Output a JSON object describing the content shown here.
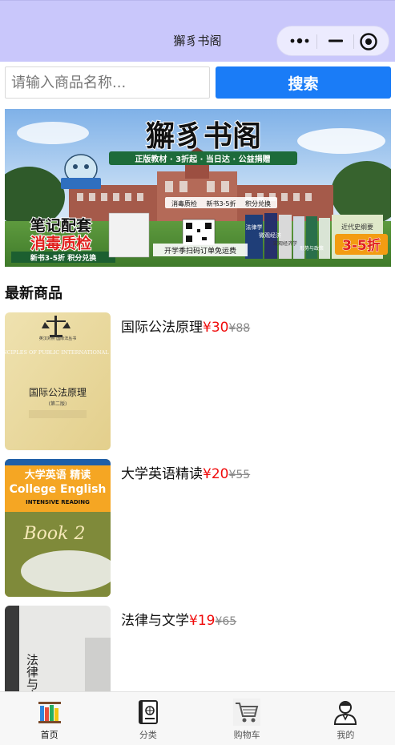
{
  "app": {
    "title": "獬豸书阁"
  },
  "search": {
    "placeholder": "请输入商品名称...",
    "button_label": "搜索"
  },
  "banner": {
    "headline": "獬豸书阁",
    "tagline": "正版教材 · 3折起 · 当日达 · 公益捐赠",
    "strip": [
      "消毒质检",
      "新书3-5折",
      "积分兑换"
    ],
    "left_line1": "笔记配套",
    "left_line2": "消毒质检",
    "left_line3": "新书3-5折 积分兑换",
    "bottom_note": "开学季扫码订单免运费",
    "discount": "3-5折",
    "book_labels": [
      "法律学",
      "微观经济",
      "宏观经济学",
      "形势与政策",
      "近代史纲要"
    ]
  },
  "section": {
    "title": "最新商品"
  },
  "products": [
    {
      "name": "国际公法原理",
      "price": "¥30",
      "original_price": "¥88",
      "cover": {
        "title": "国际公法原理",
        "subtitle": "(第二版)",
        "en": "PRINCIPLES OF PUBLIC INTERNATIONAL LAW",
        "top_label": "英汉对照 国际法丛书"
      }
    },
    {
      "name": "大学英语精读",
      "price": "¥20",
      "original_price": "¥55",
      "cover": {
        "title": "大学英语 精读",
        "en": "College English",
        "sub": "INTENSIVE READING",
        "book": "Book 2"
      }
    },
    {
      "name": "法律与文学",
      "price": "¥19",
      "original_price": "¥65",
      "cover": {
        "title": "法律与文学"
      }
    }
  ],
  "tabbar": {
    "items": [
      {
        "label": "首页",
        "icon": "bookshelf-icon"
      },
      {
        "label": "分类",
        "icon": "catalog-book-icon"
      },
      {
        "label": "购物车",
        "icon": "shopping-cart-icon"
      },
      {
        "label": "我的",
        "icon": "user-profile-icon"
      }
    ]
  },
  "colors": {
    "titlebar": "#c9c7fb",
    "accent": "#1a7cf7",
    "price": "#f00a0a"
  }
}
